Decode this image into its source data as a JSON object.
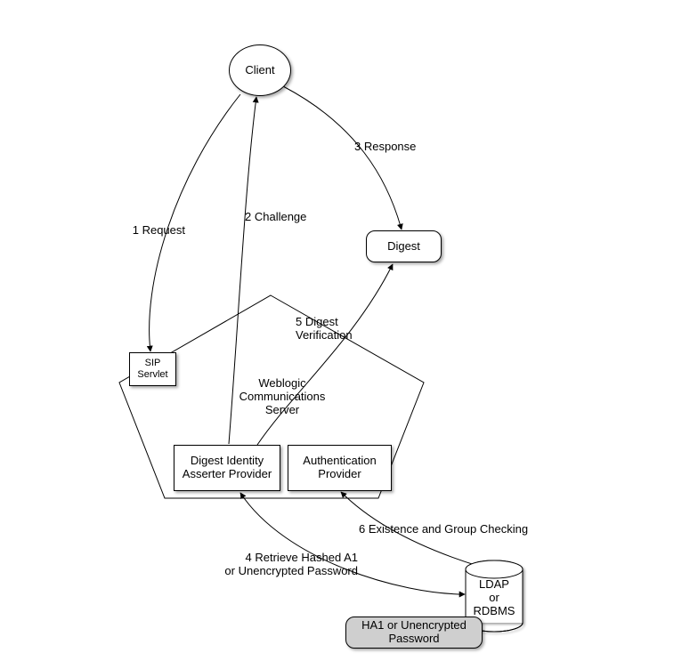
{
  "nodes": {
    "client": "Client",
    "digest": "Digest",
    "sip_servlet": "SIP\nServlet",
    "wcs": "Weblogic\nCommunications\nServer",
    "digest_identity": "Digest Identity\nAsserter\nProvider",
    "auth_provider": "Authentication\nProvider",
    "ldap": "LDAP\nor\nRDBMS",
    "ha1": "HA1 or Unencrypted\nPassword"
  },
  "edges": {
    "request": "1 Request",
    "challenge": "2 Challenge",
    "response": "3 Response",
    "retrieve": "4 Retrieve Hashed A1\nor Unencrypted Password",
    "verify": "5 Digest\nVerification",
    "existence": "6 Existence and Group Checking"
  }
}
